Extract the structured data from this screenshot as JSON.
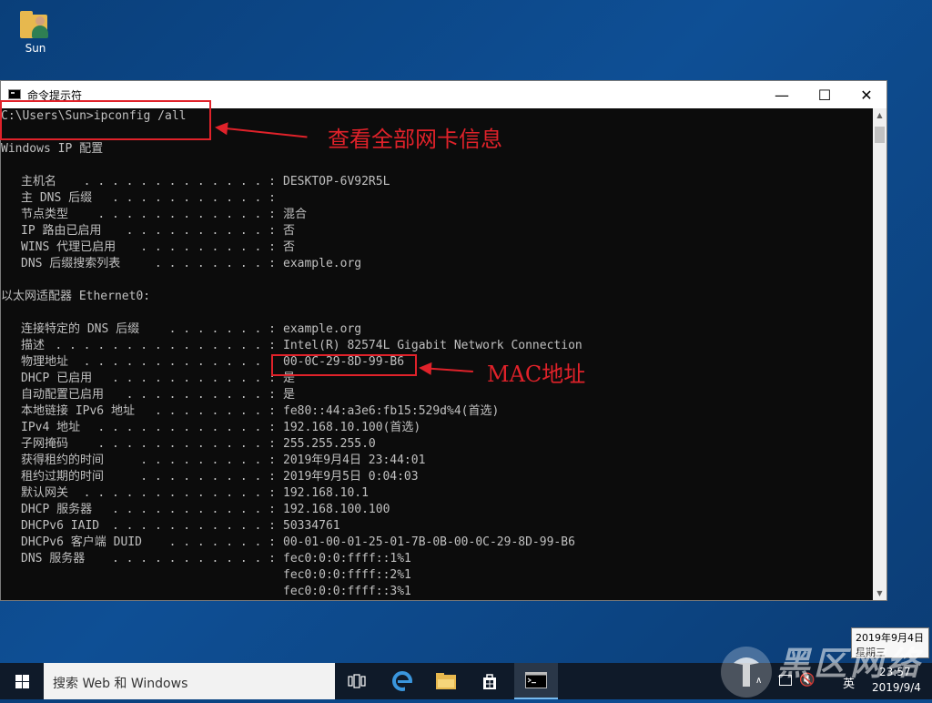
{
  "desktop": {
    "icon_label": "Sun"
  },
  "window": {
    "title": "命令提示符",
    "minimize": "—",
    "maximize": "☐",
    "close": "✕"
  },
  "console": {
    "command_line": "C:\\Users\\Sun>ipconfig /all",
    "windows_ip_header": "Windows IP 配置",
    "ip_rows": [
      {
        "label": "主机名",
        "dots": " . . . . . . . . . . . . . :",
        "value": "DESKTOP-6V92R5L"
      },
      {
        "label": "主 DNS 后缀",
        "dots": " . . . . . . . . . . . :",
        "value": ""
      },
      {
        "label": "节点类型",
        "dots": " . . . . . . . . . . . . :",
        "value": "混合"
      },
      {
        "label": "IP 路由已启用",
        "dots": " . . . . . . . . . . :",
        "value": "否"
      },
      {
        "label": "WINS 代理已启用",
        "dots": " . . . . . . . . . :",
        "value": "否"
      },
      {
        "label": "DNS 后缀搜索列表",
        "dots": " . . . . . . . . :",
        "value": "example.org"
      }
    ],
    "adapter_header": "以太网适配器 Ethernet0:",
    "adapter_rows": [
      {
        "label": "连接特定的 DNS 后缀",
        "dots": " . . . . . . . :",
        "value": "example.org"
      },
      {
        "label": "描述",
        "dots": ". . . . . . . . . . . . . . . :",
        "value": "Intel(R) 82574L Gigabit Network Connection"
      },
      {
        "label": "物理地址",
        "dots": ". . . . . . . . . . . . . :",
        "value": "00-0C-29-8D-99-B6"
      },
      {
        "label": "DHCP 已启用",
        "dots": " . . . . . . . . . . . :",
        "value": "是"
      },
      {
        "label": "自动配置已启用",
        "dots": ". . . . . . . . . . :",
        "value": "是"
      },
      {
        "label": "本地链接 IPv6 地址",
        "dots": ". . . . . . . . :",
        "value": "fe80::44:a3e6:fb15:529d%4(首选)"
      },
      {
        "label": "IPv4 地址",
        "dots": " . . . . . . . . . . . . :",
        "value": "192.168.10.100(首选)"
      },
      {
        "label": "子网掩码",
        "dots": " . . . . . . . . . . . . :",
        "value": "255.255.255.0"
      },
      {
        "label": "获得租约的时间",
        "dots": " . . . . . . . . . :",
        "value": "2019年9月4日 23:44:01"
      },
      {
        "label": "租约过期的时间",
        "dots": " . . . . . . . . . :",
        "value": "2019年9月5日 0:04:03"
      },
      {
        "label": "默认网关",
        "dots": ". . . . . . . . . . . . . :",
        "value": "192.168.10.1"
      },
      {
        "label": "DHCP 服务器",
        "dots": " . . . . . . . . . . . :",
        "value": "192.168.100.100"
      },
      {
        "label": "DHCPv6 IAID",
        "dots": " . . . . . . . . . . . :",
        "value": "50334761"
      },
      {
        "label": "DHCPv6 客户端 DUID",
        "dots": " . . . . . . . :",
        "value": "00-01-00-01-25-01-7B-0B-00-0C-29-8D-99-B6"
      },
      {
        "label": "DNS 服务器",
        "dots": " . . . . . . . . . . . :",
        "value": "fec0:0:0:ffff::1%1"
      }
    ],
    "dns_extra": [
      "fec0:0:0:ffff::2%1",
      "fec0:0:0:ffff::3%1"
    ]
  },
  "annotations": {
    "command_note": "查看全部网卡信息",
    "mac_note": "MAC地址",
    "color": "#e0222a"
  },
  "tooltip": {
    "line1": "2019年9月4日",
    "line2": "星期三"
  },
  "taskbar": {
    "search_placeholder": "搜索 Web 和 Windows",
    "ime": "英",
    "time": "23:57",
    "date": "2019/9/4"
  },
  "watermark": {
    "text": "黑区网络"
  }
}
